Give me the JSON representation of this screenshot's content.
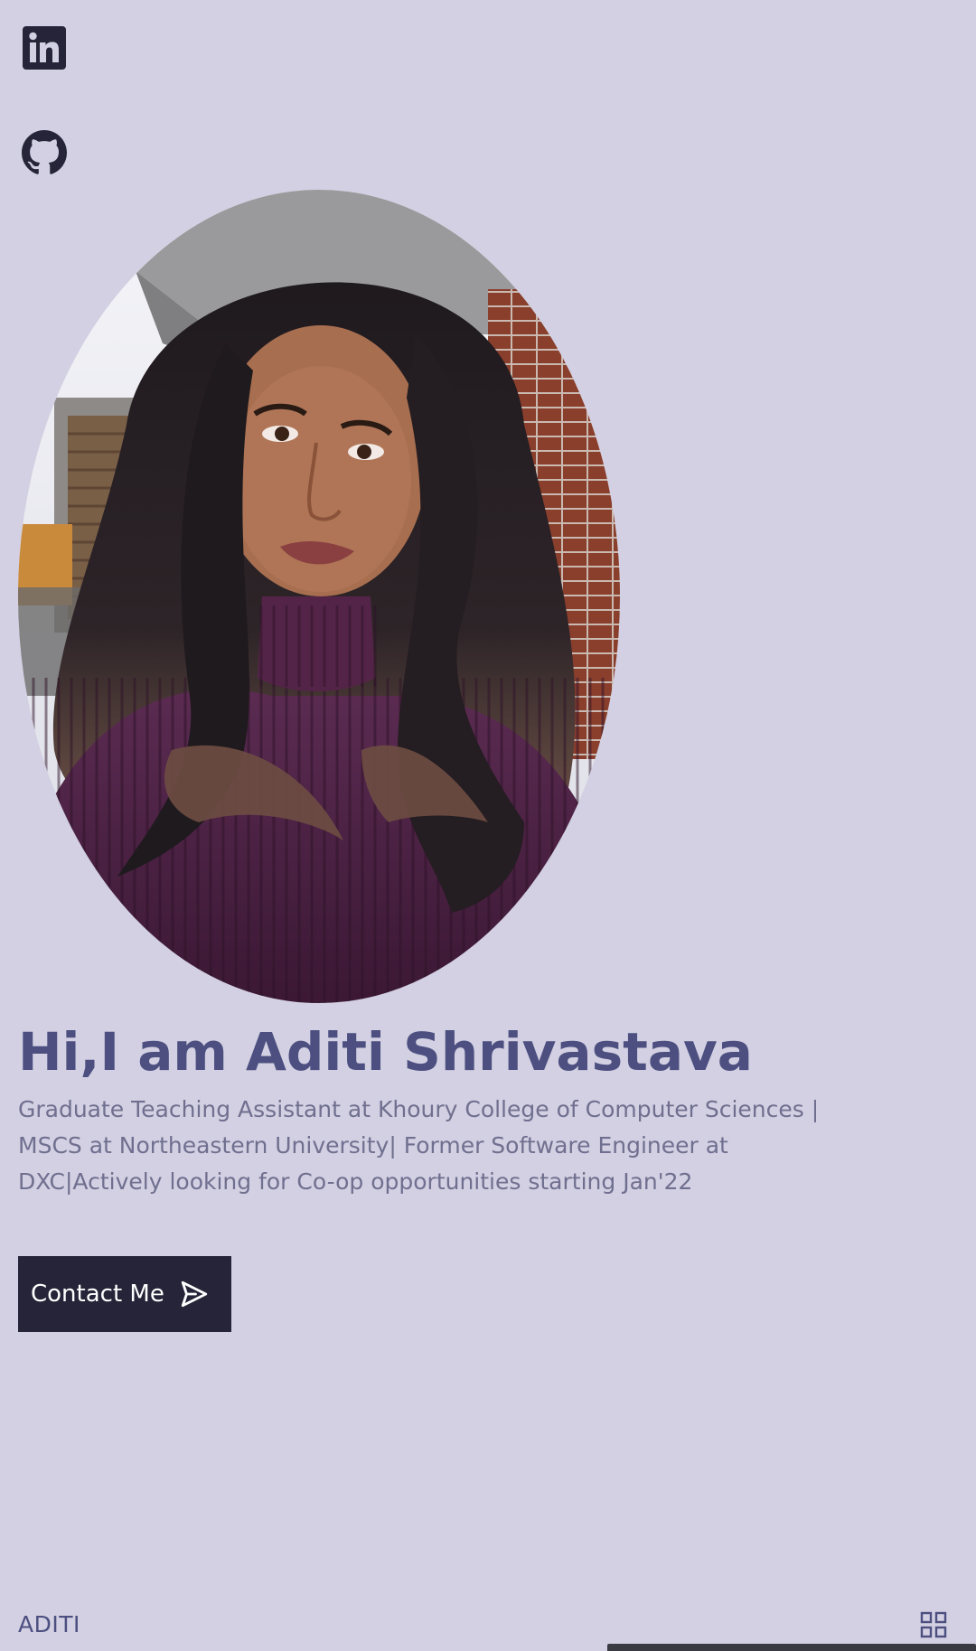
{
  "social": {
    "linkedin_icon": "linkedin-icon",
    "github_icon": "github-icon"
  },
  "hero": {
    "greeting": "Hi,I am Aditi Shrivastava",
    "description": "Graduate Teaching Assistant at Khoury College of Computer Sciences | MSCS at Northeastern University| Former Software Engineer at DXC|Actively looking for Co-op opportunities starting Jan'22",
    "contact_label": "Contact Me",
    "contact_icon": "send-icon"
  },
  "footer": {
    "brand": "ADITI",
    "menu_icon": "grid-menu-icon"
  },
  "colors": {
    "background": "#d2d0e2",
    "title": "#4c4f80",
    "text": "#706f8f",
    "button_bg": "#252438",
    "button_text": "#ffffff"
  }
}
